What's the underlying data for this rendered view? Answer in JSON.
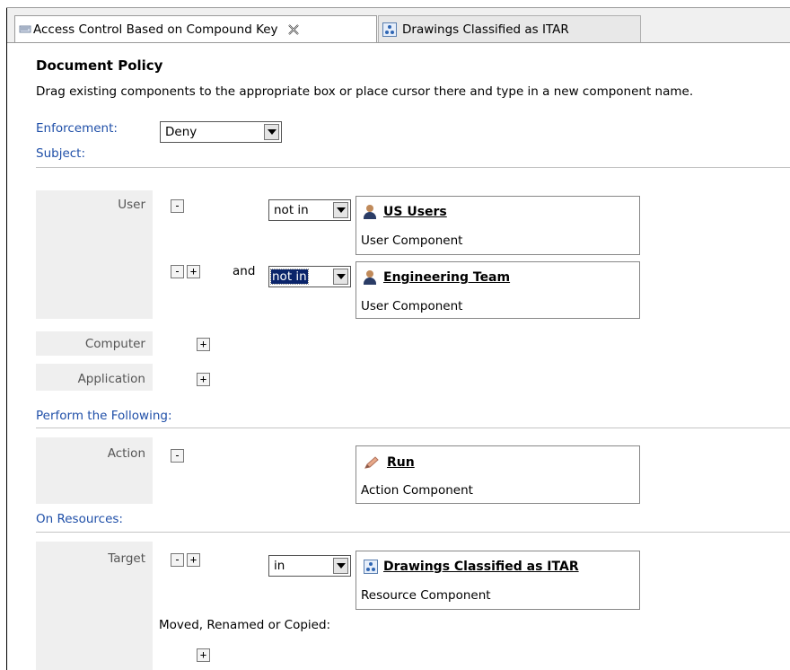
{
  "tabs": [
    {
      "label": "Access Control Based on Compound Key",
      "active": true
    },
    {
      "label": "Drawings Classified as ITAR",
      "active": false
    }
  ],
  "policy": {
    "title": "Document Policy",
    "description": "Drag existing components to the appropriate box or place cursor there and type in a new component name."
  },
  "enforcement": {
    "label": "Enforcement:",
    "value": "Deny"
  },
  "sections": {
    "subject": "Subject:",
    "perform": "Perform the Following:",
    "resources": "On Resources:"
  },
  "subject": {
    "user_label": "User",
    "computer_label": "Computer",
    "application_label": "Application",
    "conjunction": "and",
    "conditions": [
      {
        "operator": "not in",
        "name": "US Users",
        "type": "User Component",
        "selected": false
      },
      {
        "operator": "not in",
        "name": "Engineering Team",
        "type": "User Component",
        "selected": true
      }
    ]
  },
  "action": {
    "label": "Action",
    "name": "Run",
    "type": "Action Component"
  },
  "target": {
    "label": "Target",
    "operator": "in",
    "name": "Drawings Classified as ITAR",
    "type": "Resource Component",
    "moved_label": "Moved, Renamed or Copied:"
  },
  "buttons": {
    "minus": "-",
    "plus": "+"
  },
  "colors": {
    "section_text": "#1f4fa8",
    "label_panel": "#efefef",
    "selection": "#0a246a"
  },
  "icons": [
    "editor-icon",
    "close-icon",
    "resource-icon",
    "user-icon",
    "action-icon",
    "dropdown-arrow-icon"
  ]
}
